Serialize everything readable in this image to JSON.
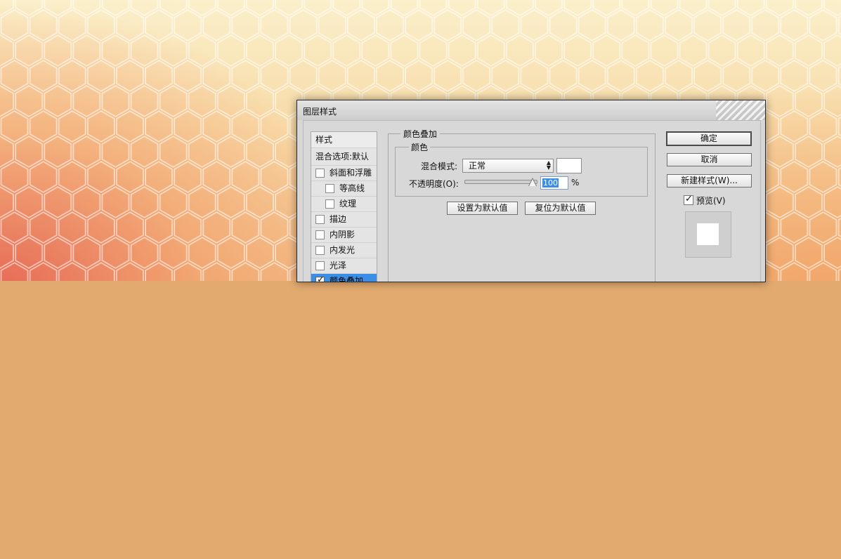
{
  "dialog": {
    "title": "图层样式",
    "sidebar": {
      "header": "样式",
      "blend_options": "混合选项:默认",
      "items": [
        {
          "label": "斜面和浮雕",
          "checked": false
        },
        {
          "label": "等高线",
          "checked": false
        },
        {
          "label": "纹理",
          "checked": false
        },
        {
          "label": "描边",
          "checked": false
        },
        {
          "label": "内阴影",
          "checked": false
        },
        {
          "label": "内发光",
          "checked": false
        },
        {
          "label": "光泽",
          "checked": false
        },
        {
          "label": "颜色叠加",
          "checked": true,
          "selected": true
        }
      ]
    },
    "panel": {
      "group_title": "颜色叠加",
      "subgroup_title": "颜色",
      "blend_mode_label": "混合模式:",
      "blend_mode_value": "正常",
      "overlay_color": "#ffffff",
      "opacity_label": "不透明度(O):",
      "opacity_value": "100",
      "opacity_unit": "%",
      "opacity_level": 100,
      "set_default_label": "设置为默认值",
      "reset_default_label": "复位为默认值"
    },
    "buttons": {
      "ok": "确定",
      "cancel": "取消",
      "new_style": "新建样式(W)..."
    },
    "preview": {
      "label": "预览(V)",
      "checked": true
    }
  },
  "colors": {
    "selection": "#3a8ee6",
    "background_lower": "#e2aa6f"
  }
}
